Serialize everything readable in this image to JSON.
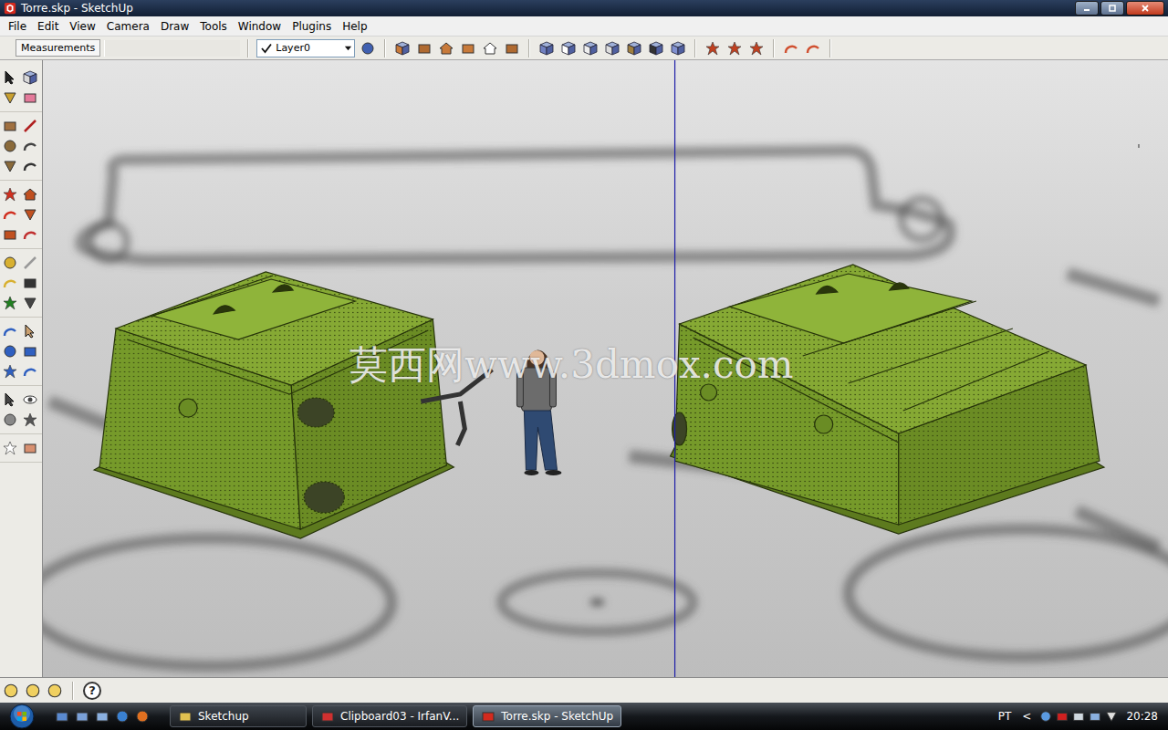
{
  "window": {
    "title": "Torre.skp - SketchUp"
  },
  "menu": [
    "File",
    "Edit",
    "View",
    "Camera",
    "Draw",
    "Tools",
    "Window",
    "Plugins",
    "Help"
  ],
  "toolbar": {
    "measurements_label": "Measurements",
    "layer": {
      "name": "Layer0",
      "visible": true
    }
  },
  "canvas": {
    "watermark": "莫西网www.3dmox.com"
  },
  "status_bar": {
    "help": "?"
  },
  "taskbar": {
    "tasks": [
      {
        "label": "Sketchup",
        "selected": false
      },
      {
        "label": "Clipboard03 - IrfanV...",
        "selected": false
      },
      {
        "label": "Torre.skp - SketchUp",
        "selected": true
      }
    ],
    "language": "PT",
    "chevron": "<",
    "clock": "20:28"
  }
}
